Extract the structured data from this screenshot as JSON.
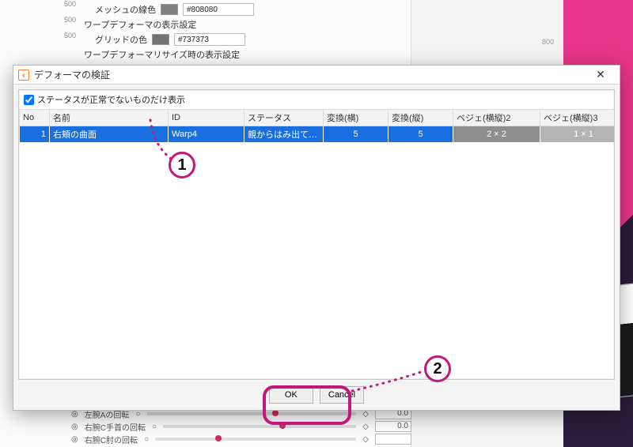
{
  "background": {
    "ruler_marks": [
      "500",
      "500",
      "500"
    ],
    "mesh_line_label": "メッシュの線色",
    "mesh_line_color": "#808080",
    "warp_section": "ワープデフォーマの表示設定",
    "grid_color_label": "グリッドの色",
    "grid_color": "#737373",
    "resize_section": "ワープデフォーマリサイズ時の表示設定",
    "bottom_rows": [
      {
        "label": "左腕Aの回転",
        "value": "0.0"
      },
      {
        "label": "右腕C手首の回転",
        "value": "0.0"
      },
      {
        "label": "右腕C肘の回転",
        "value": ""
      }
    ],
    "ruler_right_mark": "800"
  },
  "dialog": {
    "title": "デフォーマの検証",
    "checkbox_label": "ステータスが正常でないものだけ表示",
    "columns": {
      "no": "No",
      "name": "名前",
      "id": "ID",
      "status": "ステータス",
      "conv_h": "変換(横)",
      "conv_v": "変換(縦)",
      "bezier2": "ベジェ(横縦)2",
      "bezier3": "ベジェ(横縦)3"
    },
    "row": {
      "no": "1",
      "name": "右頬の曲面",
      "id": "Warp4",
      "status": "親からはみ出ている",
      "conv_h": "5",
      "conv_v": "5",
      "bezier2": "2 × 2",
      "bezier3": "1 × 1"
    },
    "buttons": {
      "ok": "OK",
      "cancel": "Cancel"
    }
  },
  "annotations": {
    "callout1": "1",
    "callout2": "2"
  }
}
